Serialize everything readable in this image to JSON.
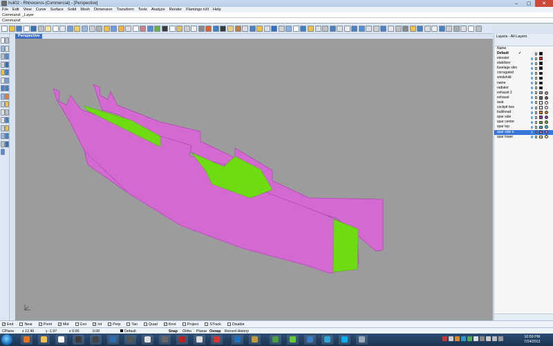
{
  "window": {
    "title": "hull02 - Rhinoceros (Commercial) - [Perspective]",
    "controls": [
      "–",
      "▢",
      "✕"
    ]
  },
  "menu": [
    "File",
    "Edit",
    "View",
    "Curve",
    "Surface",
    "Solid",
    "Mesh",
    "Dimension",
    "Transform",
    "Tools",
    "Analyze",
    "Render",
    "Flamingo nXt",
    "Help"
  ],
  "command_history": "Command: _Layer",
  "command_prompt": "Command:",
  "viewport": {
    "label": "Perspective",
    "background": "#9c9c9c",
    "part_color": "#d26ad2",
    "part_edge": "#b04ab0",
    "highlight_color": "#6edc12"
  },
  "layers_panel": {
    "title": "Layers - All Layers",
    "column_name": "Name",
    "layers": [
      {
        "name": "Default",
        "current": true,
        "color": "#000000",
        "material": null
      },
      {
        "name": "elevator",
        "color": "#e02020",
        "material": null
      },
      {
        "name": "stabilizer",
        "color": "#000000",
        "material": null
      },
      {
        "name": "fuselage skin",
        "color": "#000000",
        "material": null
      },
      {
        "name": "corrugated",
        "color": "#000000",
        "material": null
      },
      {
        "name": "windshild",
        "color": "#000000",
        "material": null
      },
      {
        "name": "name",
        "color": "#000000",
        "material": null
      },
      {
        "name": "radiator",
        "color": "#000000",
        "material": null
      },
      {
        "name": "exhaust 2",
        "color": "#a0a0a0",
        "material": "#a0a0a0"
      },
      {
        "name": "exhaust",
        "color": "#606060",
        "material": "#606060"
      },
      {
        "name": "seat",
        "color": "#ffffff",
        "material": "#ffffff"
      },
      {
        "name": "cockpit box",
        "color": "#ffffff",
        "material": "#ffffff"
      },
      {
        "name": "bulkhead",
        "color": "#e07818",
        "material": "#e07818"
      },
      {
        "name": "spar side",
        "color": "#8a3fb0",
        "material": "#8a3fb0"
      },
      {
        "name": "spar center",
        "color": "#6aa82a",
        "material": "#6aa82a"
      },
      {
        "name": "spar top",
        "color": "#28c8d8",
        "material": "#28c8d8"
      },
      {
        "name": "spar side b",
        "color": "#d870d8",
        "material": "#d870d8",
        "selected": true
      },
      {
        "name": "spar lower",
        "color": "#f0e080",
        "material": "#f0e080"
      }
    ]
  },
  "osnap": [
    {
      "label": "End",
      "checked": true
    },
    {
      "label": "Near",
      "checked": false
    },
    {
      "label": "Point",
      "checked": true
    },
    {
      "label": "Mid",
      "checked": true
    },
    {
      "label": "Cen",
      "checked": false
    },
    {
      "label": "Int",
      "checked": true
    },
    {
      "label": "Perp",
      "checked": false
    },
    {
      "label": "Tan",
      "checked": false
    },
    {
      "label": "Quad",
      "checked": false
    },
    {
      "label": "Knot",
      "checked": true
    },
    {
      "label": "Project",
      "checked": false
    },
    {
      "label": "STrack",
      "checked": false
    },
    {
      "label": "Disable",
      "checked": false
    }
  ],
  "status": {
    "cplane": "CPlane",
    "x": "x 12.46",
    "y": "y -1.97",
    "z": "z 0.00",
    "units": "0.00",
    "layer": "Default",
    "snap": "Snap",
    "ortho": "Ortho",
    "planar": "Planar",
    "osnap": "Osnap",
    "record": "Record History"
  },
  "clock": {
    "time": "10:59 PM",
    "date": "7/24/2012"
  }
}
